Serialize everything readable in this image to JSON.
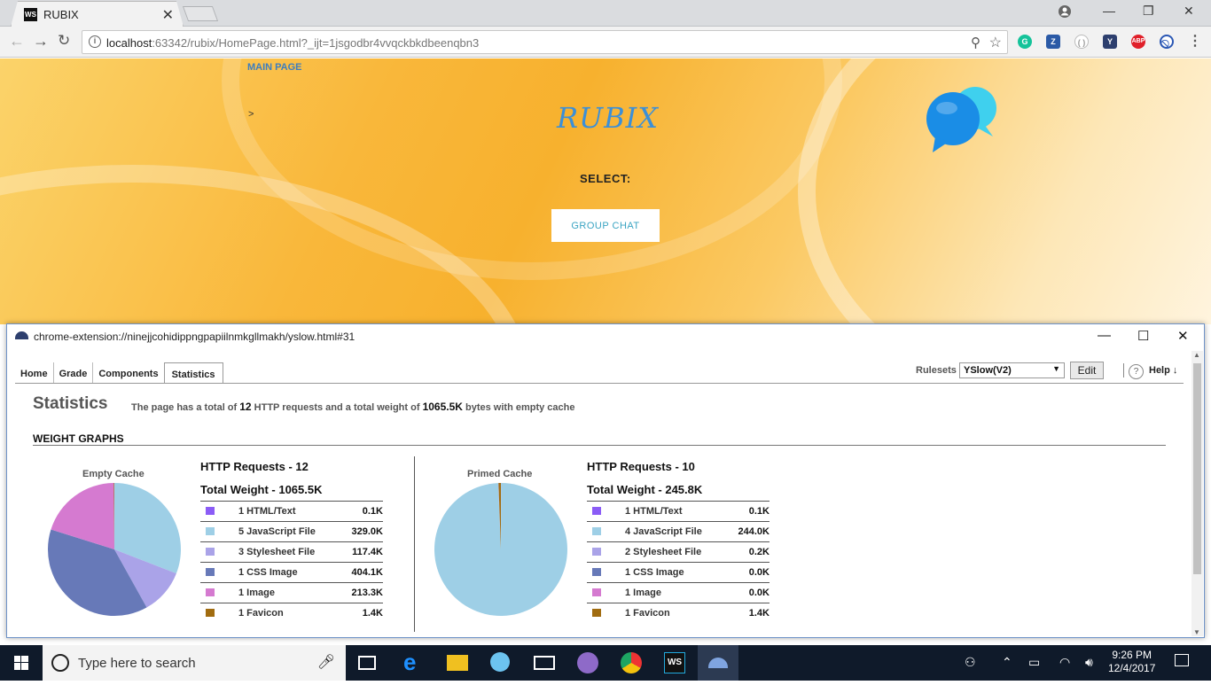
{
  "browser": {
    "tab_title": "RUBIX",
    "tab_favicon": "WS",
    "url_host": "localhost",
    "url_rest": ":63342/rubix/HomePage.html?_ijt=1jsgodbr4vvqckbkdbeenqbn3"
  },
  "page": {
    "main_page_link": "MAIN PAGE",
    "arrow": ">",
    "app_title": "RUBIX",
    "select_label": "SELECT:",
    "group_chat_button": "GROUP CHAT"
  },
  "yslow": {
    "window_title": "chrome-extension://ninejjcohidippngpapiilnmkgllmakh/yslow.html#31",
    "tabs": [
      "Home",
      "Grade",
      "Components",
      "Statistics"
    ],
    "active_tab": "Statistics",
    "rulesets_label": "Rulesets",
    "ruleset_value": "YSlow(V2)",
    "edit_button": "Edit",
    "help_icon": "?",
    "help_label": "Help ↓",
    "heading": "Statistics",
    "summary": {
      "prefix": "The page has a total of",
      "requests": "12",
      "middle": "HTTP requests and a total weight of",
      "weight": "1065.5K",
      "suffix": "bytes with empty cache"
    },
    "weight_graphs_label": "WEIGHT GRAPHS",
    "colors": {
      "html": "#8b5cf6",
      "js": "#9ecfe6",
      "css": "#aaa3e8",
      "cssimg": "#6779b8",
      "image": "#d57ad0",
      "favicon": "#a16c10"
    },
    "empty_cache": {
      "pie_label": "Empty Cache",
      "requests_title": "HTTP Requests - 12",
      "weight_title": "Total Weight - 1065.5K",
      "rows": [
        {
          "key": "html",
          "label": "1 HTML/Text",
          "value": "0.1K",
          "kb": 0.1
        },
        {
          "key": "js",
          "label": "5 JavaScript File",
          "value": "329.0K",
          "kb": 329.0
        },
        {
          "key": "css",
          "label": "3 Stylesheet File",
          "value": "117.4K",
          "kb": 117.4
        },
        {
          "key": "cssimg",
          "label": "1 CSS Image",
          "value": "404.1K",
          "kb": 404.1
        },
        {
          "key": "image",
          "label": "1 Image",
          "value": "213.3K",
          "kb": 213.3
        },
        {
          "key": "favicon",
          "label": "1 Favicon",
          "value": "1.4K",
          "kb": 1.4
        }
      ]
    },
    "primed_cache": {
      "pie_label": "Primed Cache",
      "requests_title": "HTTP Requests - 10",
      "weight_title": "Total Weight - 245.8K",
      "rows": [
        {
          "key": "html",
          "label": "1 HTML/Text",
          "value": "0.1K",
          "kb": 0.1
        },
        {
          "key": "js",
          "label": "4 JavaScript File",
          "value": "244.0K",
          "kb": 244.0
        },
        {
          "key": "css",
          "label": "2 Stylesheet File",
          "value": "0.2K",
          "kb": 0.2
        },
        {
          "key": "cssimg",
          "label": "1 CSS Image",
          "value": "0.0K",
          "kb": 0.0
        },
        {
          "key": "image",
          "label": "1 Image",
          "value": "0.0K",
          "kb": 0.0
        },
        {
          "key": "favicon",
          "label": "1 Favicon",
          "value": "1.4K",
          "kb": 1.4
        }
      ]
    }
  },
  "taskbar": {
    "search_placeholder": "Type here to search",
    "time": "9:26 PM",
    "date": "12/4/2017"
  }
}
